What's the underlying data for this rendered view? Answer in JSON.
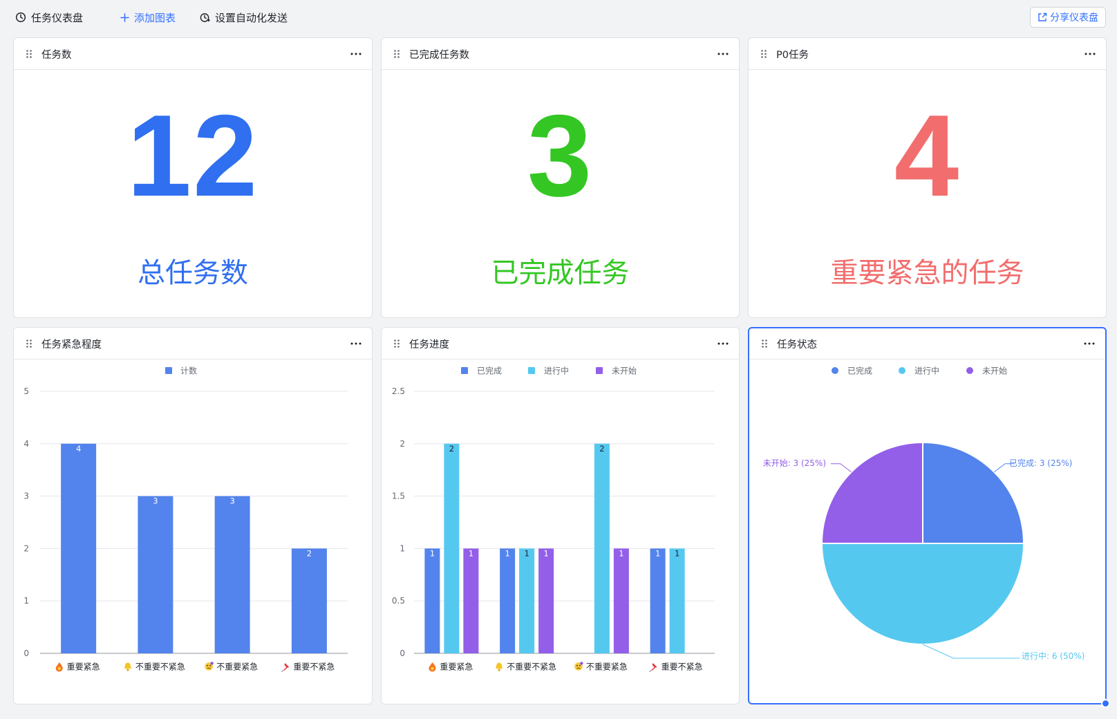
{
  "toolbar": {
    "title": "任务仪表盘",
    "add_chart": "添加图表",
    "auto_send": "设置自动化发送",
    "share": "分享仪表盘"
  },
  "colors": {
    "blue": "#2f6ff0",
    "green": "#34c724",
    "red": "#f26d6d",
    "bar_done": "#5383ec",
    "bar_doing": "#55c8f0",
    "bar_todo": "#935ee8"
  },
  "cards": {
    "total": {
      "title": "任务数",
      "value": "12",
      "caption": "总任务数"
    },
    "done": {
      "title": "已完成任务数",
      "value": "3",
      "caption": "已完成任务"
    },
    "p0": {
      "title": "P0任务",
      "value": "4",
      "caption": "重要紧急的任务"
    }
  },
  "urgency_chart": {
    "title": "任务紧急程度",
    "chart_data": {
      "type": "bar",
      "legend": [
        "计数"
      ],
      "categories": [
        "重要紧急",
        "不重要不紧急",
        "不重要紧急",
        "重要不紧急"
      ],
      "category_icons": [
        "fire-icon",
        "bell-icon",
        "confused-face-icon",
        "pushpin-icon"
      ],
      "series": [
        {
          "name": "计数",
          "values": [
            4,
            3,
            3,
            2
          ]
        }
      ],
      "ylim": [
        0,
        5
      ],
      "yticks": [
        0,
        1,
        2,
        3,
        4,
        5
      ],
      "grid": true,
      "legend_position": "top-center"
    }
  },
  "progress_chart": {
    "title": "任务进度",
    "chart_data": {
      "type": "bar",
      "categories": [
        "重要紧急",
        "不重要不紧急",
        "不重要紧急",
        "重要不紧急"
      ],
      "category_icons": [
        "fire-icon",
        "bell-icon",
        "confused-face-icon",
        "pushpin-icon"
      ],
      "series": [
        {
          "name": "已完成",
          "values": [
            1,
            1,
            0,
            1
          ]
        },
        {
          "name": "进行中",
          "values": [
            2,
            1,
            2,
            1
          ]
        },
        {
          "name": "未开始",
          "values": [
            1,
            1,
            1,
            0
          ]
        }
      ],
      "ylim": [
        0,
        2.5
      ],
      "yticks": [
        0,
        0.5,
        1,
        1.5,
        2,
        2.5
      ],
      "grid": true,
      "legend_position": "top-center"
    }
  },
  "status_chart": {
    "title": "任务状态",
    "chart_data": {
      "type": "pie",
      "slices": [
        {
          "name": "已完成",
          "value": 3,
          "label": "已完成: 3 (25%)"
        },
        {
          "name": "进行中",
          "value": 6,
          "label": "进行中: 6 (50%)"
        },
        {
          "name": "未开始",
          "value": 3,
          "label": "未开始: 3 (25%)"
        }
      ],
      "legend_position": "top-center"
    }
  }
}
